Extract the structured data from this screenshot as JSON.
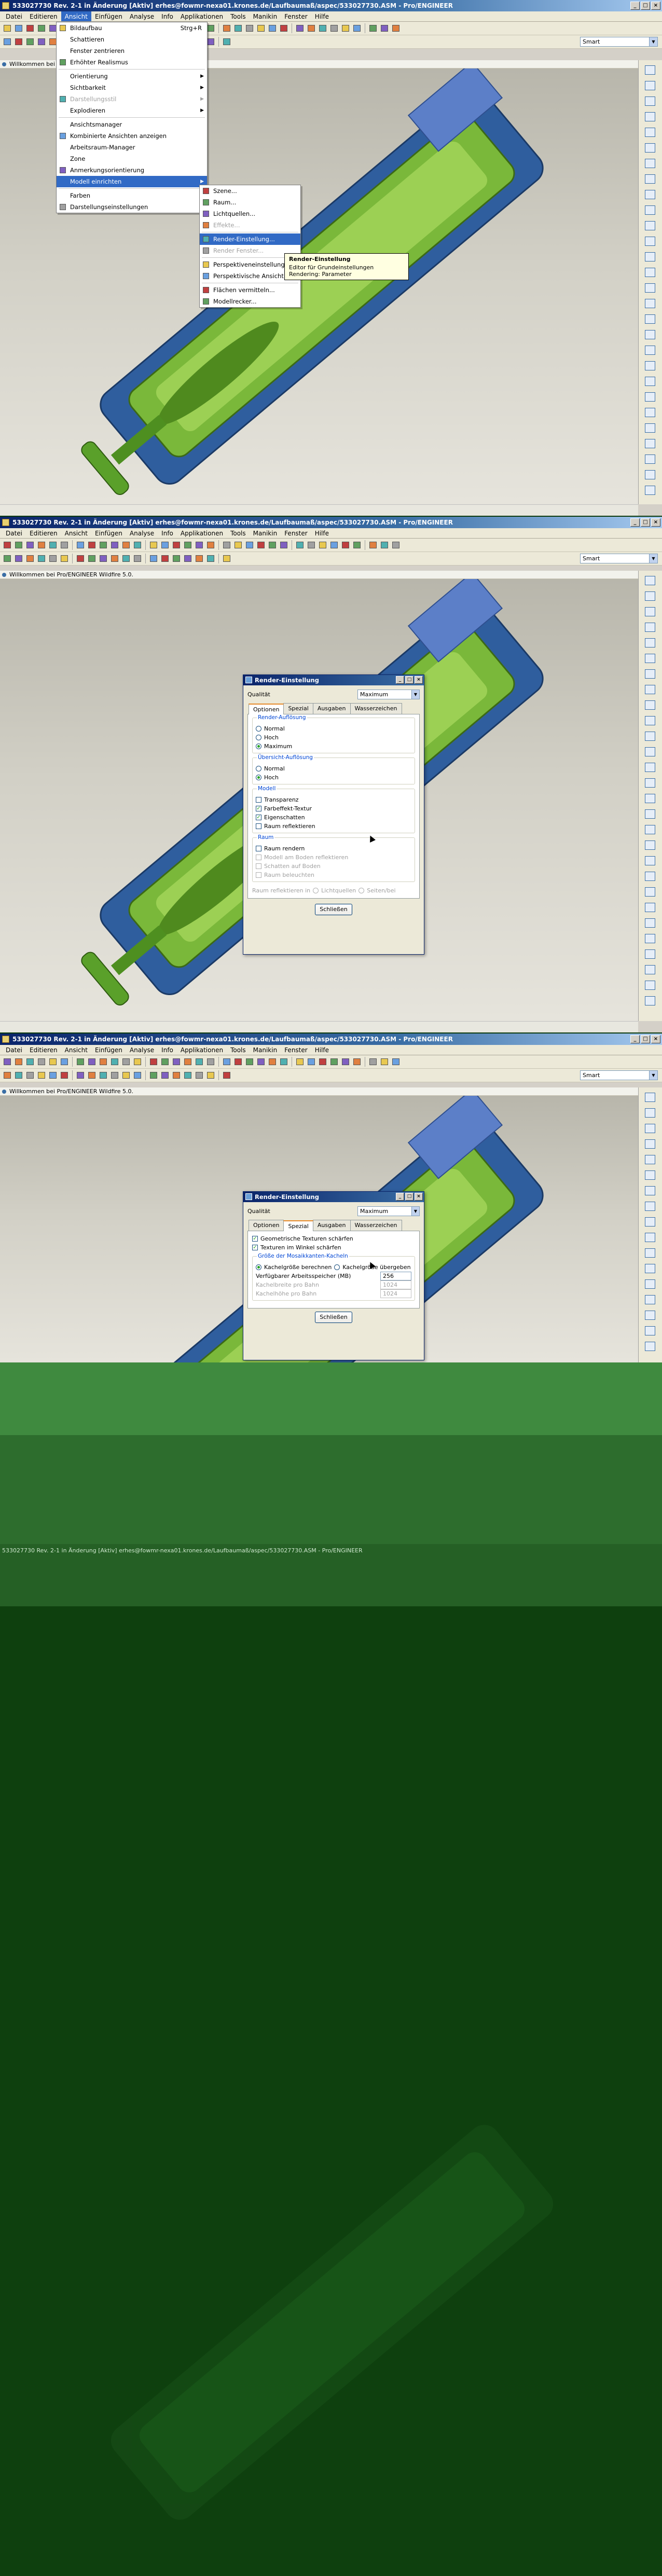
{
  "window": {
    "title": "533027730 Rev. 2-1 in Änderung [Aktiv] erhes@fowmr-nexa01.krones.de/Laufbaumaß/aspec/533027730.ASM - Pro/ENGINEER",
    "title_short": "533027730 Rev. 2-1 in Änderung [Aktiv] erhes@fowmr-nexa01.krones.de/Laufbaumaß/aspec/533027730.ASM - Pro/ENGINEER",
    "min": "_",
    "max": "□",
    "close": "×"
  },
  "menubar": [
    "Datei",
    "Editieren",
    "Ansicht",
    "Einfügen",
    "Analyse",
    "Info",
    "Applikationen",
    "Tools",
    "Manikin",
    "Fenster",
    "Hilfe"
  ],
  "status_message": "Willkommen bei Pro/ENGINEER Wildfire 5.0.",
  "smart_filter": "Smart",
  "ansicht_menu": {
    "items": [
      {
        "label": "Bildaufbau",
        "shortcut": "Strg+R",
        "disabled": false
      },
      {
        "label": "Schattieren",
        "shortcut": "",
        "disabled": false
      },
      {
        "label": "Fenster zentrieren",
        "shortcut": "",
        "disabled": false
      },
      {
        "label": "Erhöhter Realismus",
        "shortcut": "",
        "disabled": false
      },
      {
        "label": "Orientierung",
        "shortcut": "",
        "disabled": false,
        "submenu": true
      },
      {
        "label": "Sichtbarkeit",
        "shortcut": "",
        "disabled": false,
        "submenu": true
      },
      {
        "label": "Darstellungsstil",
        "shortcut": "",
        "disabled": true,
        "submenu": true
      },
      {
        "label": "Explodieren",
        "shortcut": "",
        "disabled": false,
        "submenu": true
      },
      {
        "label": "Ansichtsmanager",
        "shortcut": "",
        "disabled": false
      },
      {
        "label": "Kombinierte Ansichten anzeigen",
        "shortcut": "",
        "disabled": false
      },
      {
        "label": "Arbeitsraum-Manager",
        "shortcut": "",
        "disabled": false
      },
      {
        "label": "Zone",
        "shortcut": "",
        "disabled": false
      },
      {
        "label": "Anmerkungsorientierung",
        "shortcut": "",
        "disabled": false
      },
      {
        "label": "Modell einrichten",
        "shortcut": "",
        "disabled": false,
        "submenu": true,
        "highlighted": true
      },
      {
        "label": "Farben",
        "shortcut": "",
        "disabled": false
      },
      {
        "label": "Darstellungseinstellungen",
        "shortcut": "",
        "disabled": false,
        "submenu": true
      }
    ]
  },
  "modell_submenu": {
    "items": [
      {
        "label": "Szene...",
        "disabled": false
      },
      {
        "label": "Raum...",
        "disabled": false
      },
      {
        "label": "Lichtquellen...",
        "disabled": false
      },
      {
        "label": "Effekte...",
        "disabled": true
      },
      {
        "label": "Render-Einstellung...",
        "disabled": false,
        "highlighted": true
      },
      {
        "label": "Render Fenster...",
        "disabled": true
      },
      {
        "label": "Perspektiveneinstellungen...",
        "disabled": false
      },
      {
        "label": "Perspektivische Ansicht",
        "disabled": false
      },
      {
        "label": "Flächen vermitteln...",
        "disabled": false
      },
      {
        "label": "Modellrecker...",
        "disabled": false
      }
    ]
  },
  "tooltip": {
    "title": "Render-Einstellung",
    "text": "Editor für Grundeinstellungen Rendering: Parameter"
  },
  "render_dialog": {
    "title": "Render-Einstellung",
    "quality_label": "Qualität",
    "quality_value": "Maximum",
    "tabs": [
      "Optionen",
      "Spezial",
      "Ausgaben",
      "Wasserzeichen"
    ],
    "options_tab": {
      "render_aufloesung": {
        "legend": "Render-Auflösung",
        "options": [
          "Normal",
          "Hoch",
          "Maximum"
        ],
        "selected": "Maximum"
      },
      "uebersicht_aufloesung": {
        "legend": "Übersicht-Auflösung",
        "options": [
          "Normal",
          "Hoch"
        ],
        "selected": "Hoch"
      },
      "modell": {
        "legend": "Modell",
        "options": [
          {
            "label": "Transparenz",
            "checked": false,
            "disabled": false
          },
          {
            "label": "Farbeffekt-Textur",
            "checked": true,
            "disabled": false
          },
          {
            "label": "Eigenschatten",
            "checked": true,
            "disabled": false
          },
          {
            "label": "Raum reflektieren",
            "checked": false,
            "disabled": false
          }
        ]
      },
      "raum": {
        "legend": "Raum",
        "options": [
          {
            "label": "Raum rendern",
            "checked": false,
            "disabled": false
          },
          {
            "label": "Modell am Boden reflektieren",
            "checked": false,
            "disabled": true
          },
          {
            "label": "Schatten auf Boden",
            "checked": false,
            "disabled": true
          },
          {
            "label": "Raum beleuchten",
            "checked": false,
            "disabled": true
          }
        ]
      },
      "reflection_row": {
        "label": "Raum reflektieren in",
        "option1": "Lichtquellen",
        "option2": "Seiten/bei"
      }
    },
    "spezial_tab": {
      "checks": [
        {
          "label": "Geometrische Texturen schärfen",
          "checked": true
        },
        {
          "label": "Texturen im Winkel schärfen",
          "checked": true
        }
      ],
      "mosaik": {
        "legend": "Größe der Mosaikkanten-Kacheln",
        "radio_left": "Kachelgröße berechnen",
        "radio_right": "Kachelgröße übergeben",
        "memory_label": "Verfügbarer Arbeitsspeicher (MB)",
        "memory_value": "256",
        "width_label": "Kachelbreite pro Bahn",
        "width_value": "1024",
        "height_label": "Kachelhöhe pro Bahn",
        "height_value": "1024"
      }
    },
    "close_button": "Schließen"
  },
  "colors": {
    "part_blue": "#3f6fb0",
    "part_green": "#6aa82e",
    "title_blue": "#0a246a",
    "highlight": "#316ac5"
  }
}
